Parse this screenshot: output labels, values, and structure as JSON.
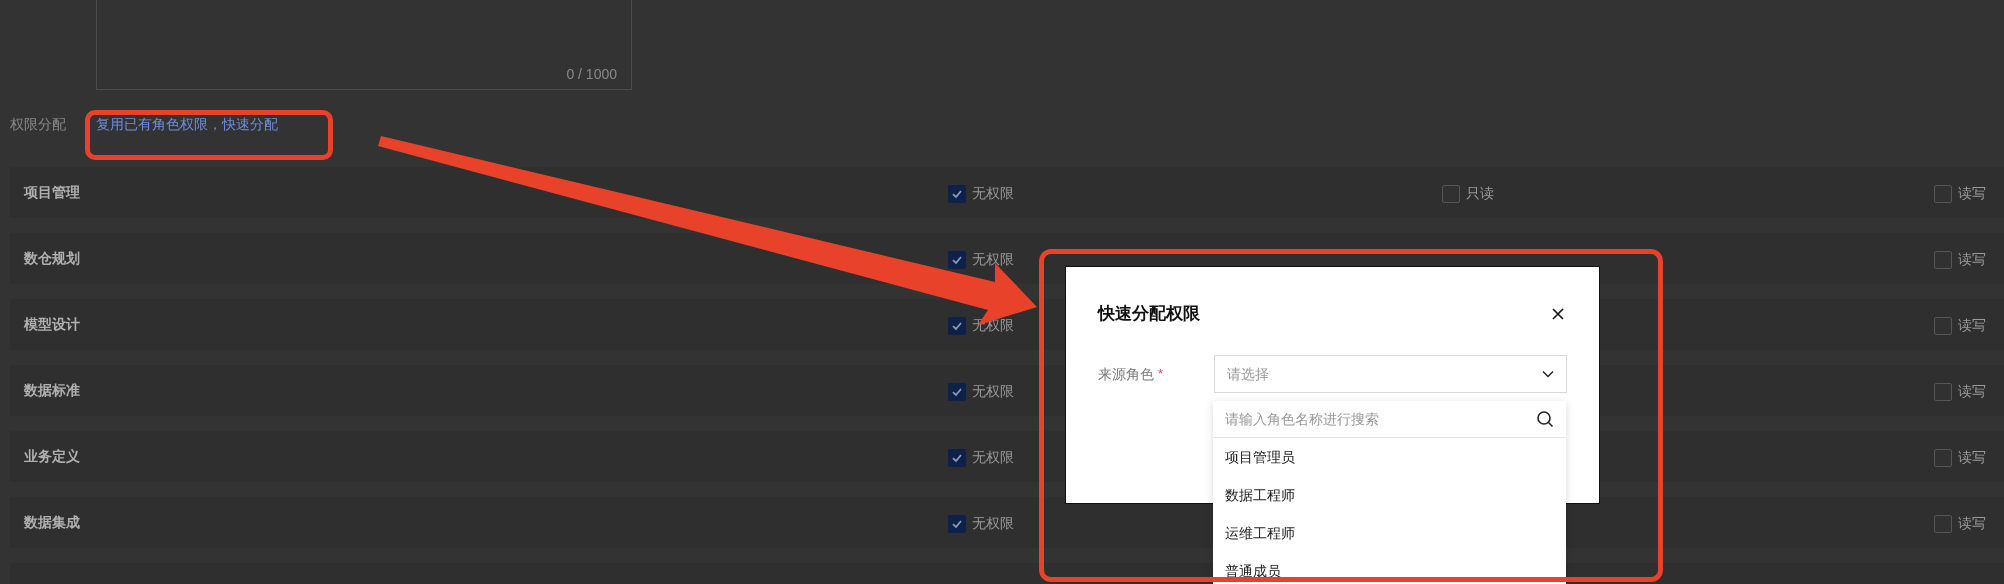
{
  "textarea": {
    "counter": "0 / 1000"
  },
  "permission": {
    "label": "权限分配",
    "link": "复用已有角色权限，快速分配"
  },
  "modules": [
    {
      "name": "项目管理",
      "options": [
        {
          "kind": "none",
          "label": "无权限",
          "checked": true
        },
        {
          "kind": "read",
          "label": "只读",
          "checked": false
        },
        {
          "kind": "write",
          "label": "读写",
          "checked": false
        }
      ]
    },
    {
      "name": "数仓规划",
      "options": [
        {
          "kind": "none",
          "label": "无权限",
          "checked": true
        },
        {
          "kind": "write",
          "label": "读写",
          "checked": false
        }
      ]
    },
    {
      "name": "模型设计",
      "options": [
        {
          "kind": "none",
          "label": "无权限",
          "checked": true
        },
        {
          "kind": "write",
          "label": "读写",
          "checked": false
        }
      ]
    },
    {
      "name": "数据标准",
      "options": [
        {
          "kind": "none",
          "label": "无权限",
          "checked": true
        },
        {
          "kind": "write",
          "label": "读写",
          "checked": false
        }
      ]
    },
    {
      "name": "业务定义",
      "options": [
        {
          "kind": "none",
          "label": "无权限",
          "checked": true
        },
        {
          "kind": "write",
          "label": "读写",
          "checked": false
        }
      ]
    },
    {
      "name": "数据集成",
      "options": [
        {
          "kind": "none",
          "label": "无权限",
          "checked": true
        },
        {
          "kind": "write",
          "label": "读写",
          "checked": false
        }
      ]
    }
  ],
  "dialog": {
    "title": "快速分配权限",
    "field": {
      "label": "来源角色",
      "required_mark": "*",
      "placeholder": "请选择"
    },
    "dropdown": {
      "search_placeholder": "请输入角色名称进行搜索",
      "options": [
        "项目管理员",
        "数据工程师",
        "运维工程师",
        "普通成员"
      ]
    }
  }
}
